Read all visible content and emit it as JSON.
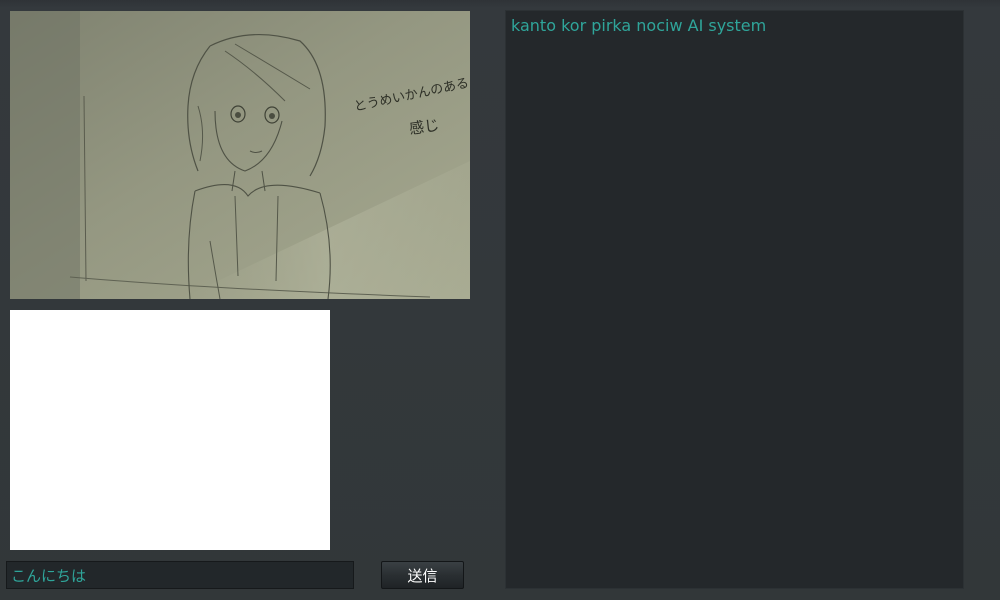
{
  "output": {
    "title": "kanto kor pirka nociw AI system"
  },
  "photo": {
    "handwritten_note_line1": "とうめいかんのある",
    "handwritten_note_line2": "感じ"
  },
  "input": {
    "value": "こんにちは"
  },
  "send_button": {
    "label": "送信"
  },
  "colors": {
    "accent_text": "#2fa59a",
    "panel_background": "#24282b",
    "page_background": "#323739",
    "drawing_canvas": "#ffffff"
  }
}
